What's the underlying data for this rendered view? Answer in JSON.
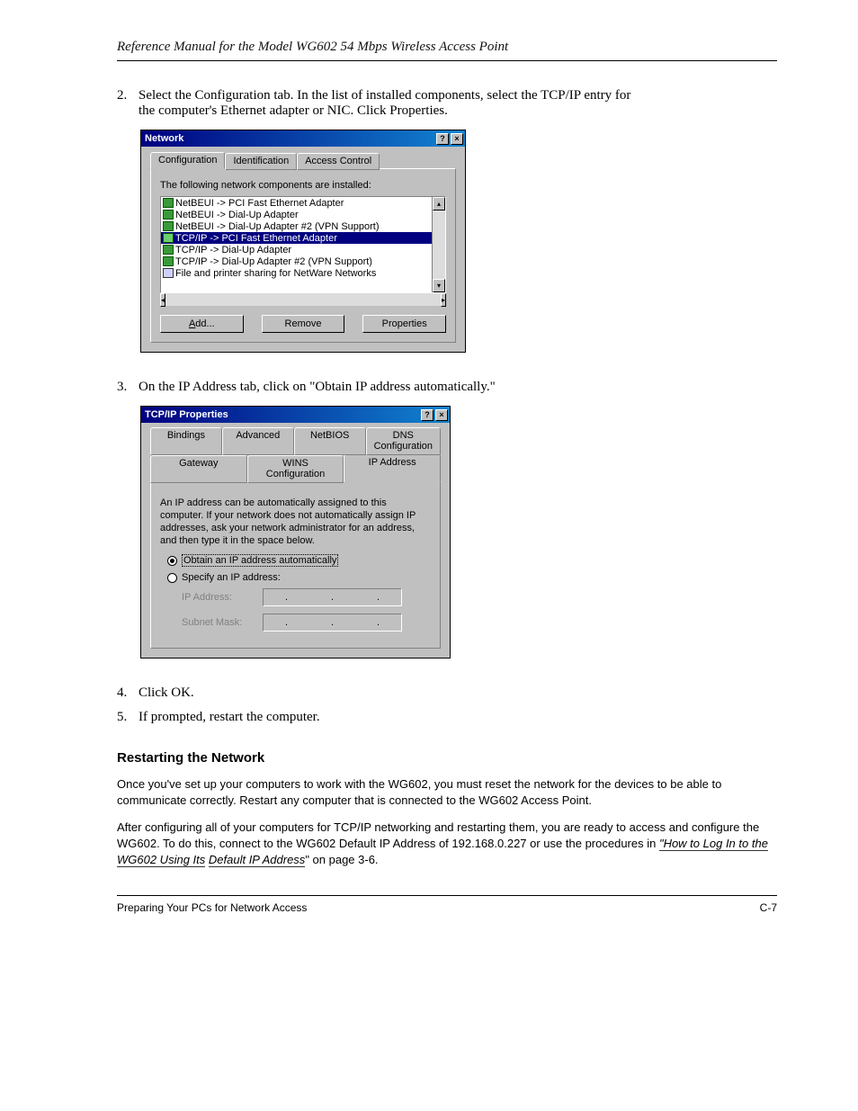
{
  "header": {
    "left": "Reference Manual for the Model WG602 54 Mbps Wireless Access Point"
  },
  "steps": {
    "step2_intro": "Select the Configuration tab. In the list of installed components, select the TCP/IP entry for",
    "step2_intro2": "the computer's Ethernet adapter or NIC. Click Properties.",
    "step3": "On the IP Address tab, click on \"Obtain IP address automatically.\"",
    "step4": "Click OK.",
    "step5": "If prompted, restart the computer."
  },
  "network_dialog": {
    "title": "Network",
    "tabs": [
      "Configuration",
      "Identification",
      "Access Control"
    ],
    "label": "The following network components are installed:",
    "items": [
      "NetBEUI -> PCI Fast Ethernet Adapter",
      "NetBEUI -> Dial-Up Adapter",
      "NetBEUI -> Dial-Up Adapter #2 (VPN Support)",
      "TCP/IP -> PCI Fast Ethernet Adapter",
      "TCP/IP -> Dial-Up Adapter",
      "TCP/IP -> Dial-Up Adapter #2 (VPN Support)",
      "File and printer sharing for NetWare Networks"
    ],
    "buttons": {
      "add": "Add...",
      "remove": "Remove",
      "props": "Properties"
    }
  },
  "tcpip_dialog": {
    "title": "TCP/IP Properties",
    "tabs_back": [
      "Bindings",
      "Advanced",
      "NetBIOS",
      "DNS Configuration"
    ],
    "tabs_front": [
      "Gateway",
      "WINS Configuration",
      "IP Address"
    ],
    "info": "An IP address can be automatically assigned to this computer. If your network does not automatically assign IP addresses, ask your network administrator for an address, and then type it in the space below.",
    "radio_auto": "Obtain an IP address automatically",
    "radio_specify": "Specify an IP address:",
    "ip_label": "IP Address:",
    "mask_label": "Subnet Mask:"
  },
  "restart": {
    "heading": "Restarting the Network",
    "p1": "Once you've set up your computers to work with the WG602, you must reset the network for the devices to be able to communicate correctly. Restart any computer that is connected to the WG602 Access Point.",
    "p2a": "After configuring all of your computers for TCP/IP networking and restarting them, you are ready to access and configure the WG602. To do this, connect to the WG602 Default IP Address of 192.168.0.227 or use the procedures in ",
    "p2_link": "\"How to Log In to the WG602 Using Its",
    "p2b": "\" on page 3-6."
  },
  "footer": {
    "left": "Preparing Your PCs for Network Access",
    "right": "C-7"
  }
}
